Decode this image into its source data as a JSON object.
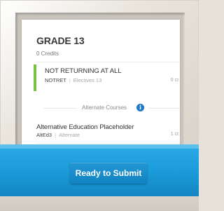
{
  "grade": {
    "title": "GRADE 13",
    "credits": "0 Credits"
  },
  "course": {
    "name": "NOT RETURNING AT ALL",
    "code": "NOTRET",
    "category": "Electives 13",
    "credits": "0 cr.",
    "status_color": "#7cc242"
  },
  "alternates": {
    "header": "Alternate Courses",
    "info_icon": "info-icon",
    "items": [
      {
        "name": "Alternative Education Placeholder",
        "code": "AltEd3",
        "category": "Alternate",
        "credits": "1 cr."
      }
    ]
  },
  "submit": {
    "label": "Ready to Submit",
    "color": "#1a9ad8"
  }
}
